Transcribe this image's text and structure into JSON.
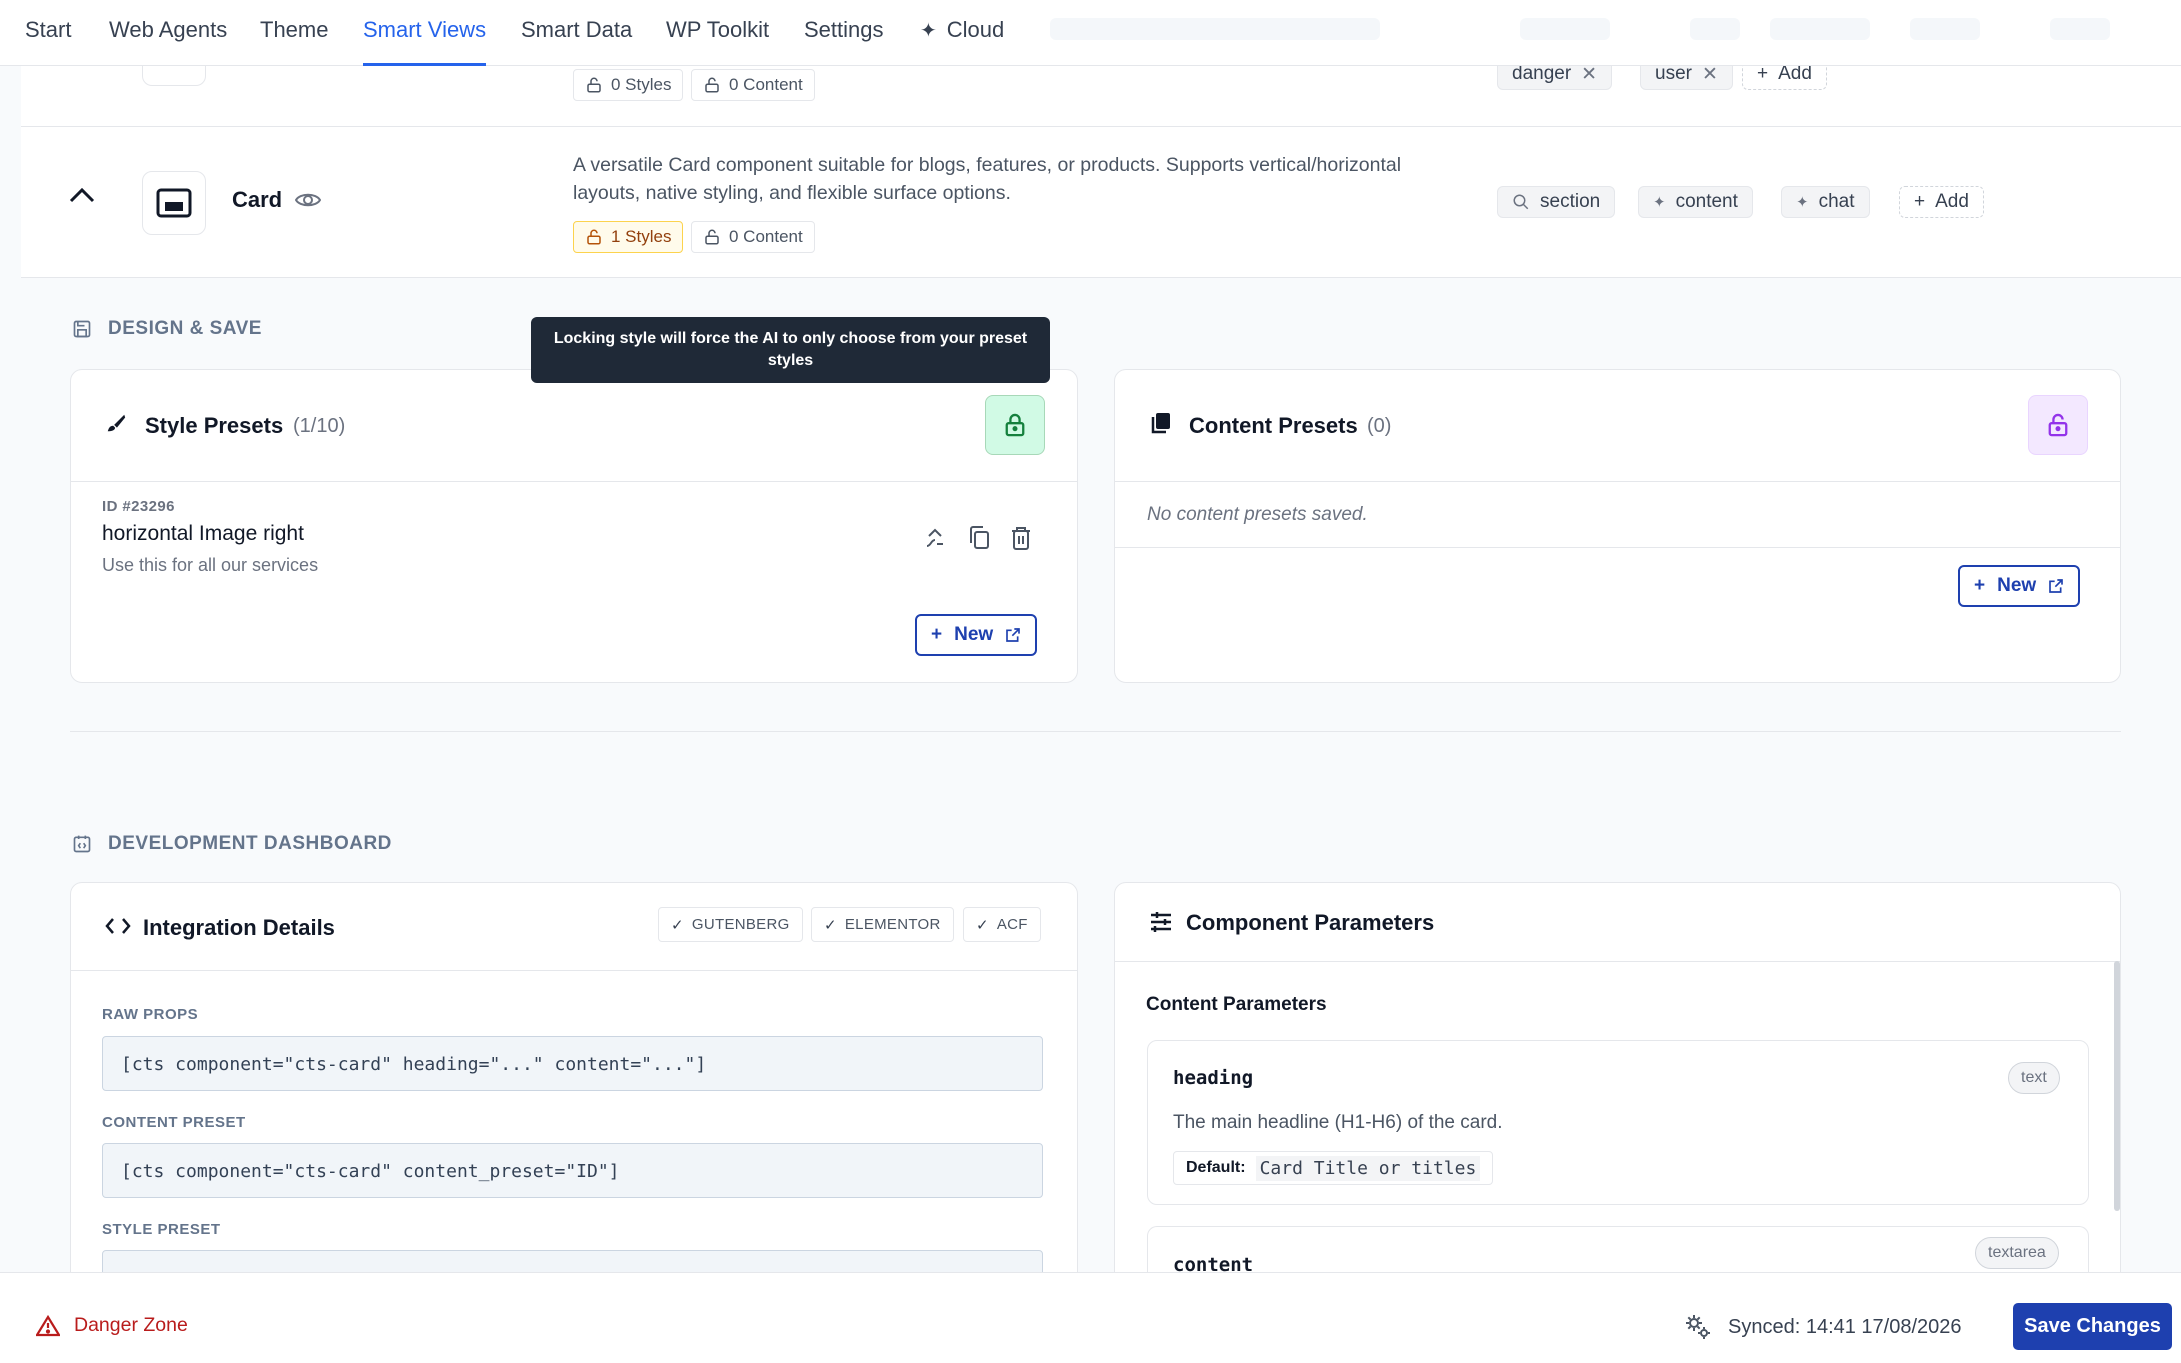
{
  "nav": {
    "items": [
      "Start",
      "Web Agents",
      "Theme",
      "Smart Views",
      "Smart Data",
      "WP Toolkit",
      "Settings",
      "Cloud"
    ],
    "active": "Smart Views"
  },
  "prev_component": {
    "styles_badge": "0 Styles",
    "content_badge": "0 Content",
    "tags": [
      "danger",
      "user"
    ],
    "add_label": "Add"
  },
  "card_component": {
    "name": "Card",
    "description": "A versatile Card component suitable for blogs, features, or products. Supports vertical/horizontal layouts, native styling, and flexible surface options.",
    "styles_badge": "1 Styles",
    "content_badge": "0 Content",
    "tags": [
      "section",
      "content",
      "chat"
    ],
    "add_label": "Add"
  },
  "design_save": {
    "section_title": "DESIGN & SAVE",
    "tooltip": "Locking style will force the AI to only choose from your preset styles",
    "style_presets": {
      "title": "Style Presets",
      "count": "(1/10)",
      "item": {
        "id": "ID #23296",
        "name": "horizontal Image right",
        "description": "Use this for all our services"
      },
      "new_label": "New"
    },
    "content_presets": {
      "title": "Content Presets",
      "count": "(0)",
      "empty_text": "No content presets saved.",
      "new_label": "New"
    }
  },
  "dev_dashboard": {
    "section_title": "DEVELOPMENT DASHBOARD",
    "integration": {
      "title": "Integration Details",
      "badges": [
        "GUTENBERG",
        "ELEMENTOR",
        "ACF"
      ],
      "raw_props_label": "RAW PROPS",
      "raw_props": "[cts component=\"cts-card\" heading=\"...\" content=\"...\"]",
      "content_preset_label": "CONTENT PRESET",
      "content_preset": "[cts component=\"cts-card\" content_preset=\"ID\"]",
      "style_preset_label": "STYLE PRESET"
    },
    "parameters": {
      "title": "Component Parameters",
      "group_title": "Content Parameters",
      "params": [
        {
          "name": "heading",
          "type": "text",
          "description": "The main headline (H1-H6) of the card.",
          "default_label": "Default:",
          "default_value": "Card Title or titles"
        },
        {
          "name": "content",
          "type": "textarea"
        }
      ]
    }
  },
  "footer": {
    "danger_zone": "Danger Zone",
    "synced": "Synced: 14:41 17/08/2026",
    "save_label": "Save Changes"
  },
  "colors": {
    "accent": "#2563eb",
    "primary_button": "#1e40af",
    "danger": "#b91c1c",
    "tooltip_bg": "#1f2937"
  }
}
